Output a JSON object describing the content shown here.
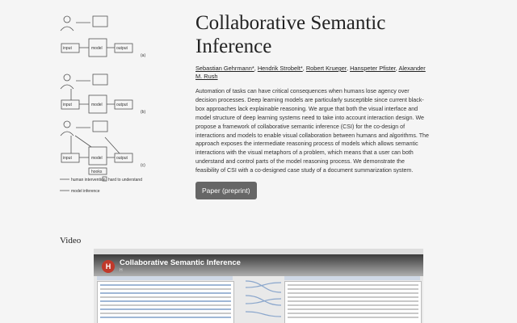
{
  "figure": {
    "labels": {
      "input": "input",
      "model": "model",
      "output": "output",
      "hooks": "hooks",
      "panel_a": "(a)",
      "panel_b": "(b)",
      "panel_c": "(c)"
    },
    "legend": [
      "human intervention",
      "hard to understand",
      "model inference"
    ]
  },
  "paper": {
    "title": "Collaborative Semantic Inference",
    "authors": [
      "Sebastian Gehrmann*",
      "Hendrik Strobelt*",
      "Robert Krueger",
      "Hanspeter Pfister",
      "Alexander M. Rush"
    ],
    "abstract": "Automation of tasks can have critical consequences when humans lose agency over decision processes. Deep learning models are particularly susceptible since current black-box approaches lack explainable reasoning. We argue that both the visual interface and model structure of deep learning systems need to take into account interaction design. We propose a framework of collaborative semantic inference (CSI) for the co-design of interactions and models to enable visual collaboration between humans and algorithms. The approach exposes the intermediate reasoning process of models which allows semantic interactions with the visual metaphors of a problem, which means that a user can both understand and control parts of the model reasoning process. We demonstrate the feasibility of CSI with a co-designed case study of a document summarization system.",
    "paper_button": "Paper (preprint)"
  },
  "video": {
    "label": "Video",
    "title": "Collaborative Semantic Inference",
    "channel": "H",
    "avatar_letter": "H"
  },
  "colors": {
    "button_bg": "#666666",
    "video_avatar": "#c0392b"
  }
}
